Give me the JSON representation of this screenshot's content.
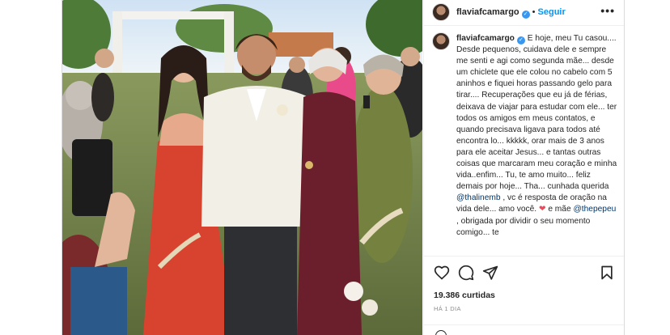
{
  "post": {
    "username": "flaviafcamargo",
    "follow_label": "Seguir",
    "more_label": "•••",
    "caption_parts": {
      "username": "flaviafcamargo",
      "text_1": " E hoje, meu Tu casou.... Desde pequenos, cuidava dele e sempre me senti e agi como segunda mãe... desde um chiclete que ele colou no cabelo com 5 aninhos e fiquei horas passando gelo para tirar.... Recuperações que eu já de férias, deixava de viajar para estudar com ele... ter todos os amigos em meus contatos, e quando precisava ligava para todos até encontra lo... kkkkk, orar mais de 3 anos para ele aceitar Jesus... e tantas outras coisas que marcaram meu coração e minha vida..enfim... Tu, te amo muito... feliz demais por hoje... Tha... cunhada querida ",
      "mention_1": "@thalinemb",
      "text_2": " , vc é resposta de oração na vida dele... amo você. ",
      "heart": "❤",
      "text_3": " e mãe ",
      "mention_2": "@thepepeu",
      "text_4": " , obrigada por dividir o seu momento comigo... te"
    },
    "likes": "19.386 curtidas",
    "time_ago": "HÁ 1 DIA"
  },
  "icons": {
    "like": "heart-outline-icon",
    "comment": "comment-bubble-icon",
    "share": "paper-plane-icon",
    "save": "bookmark-icon",
    "emoji": "emoji-smile-icon",
    "verified": "verified-badge-icon"
  },
  "colors": {
    "accent_blue": "#0095f6",
    "verified_blue": "#3897f0",
    "border": "#dbdbdb",
    "muted_text": "#8e8e8e"
  }
}
